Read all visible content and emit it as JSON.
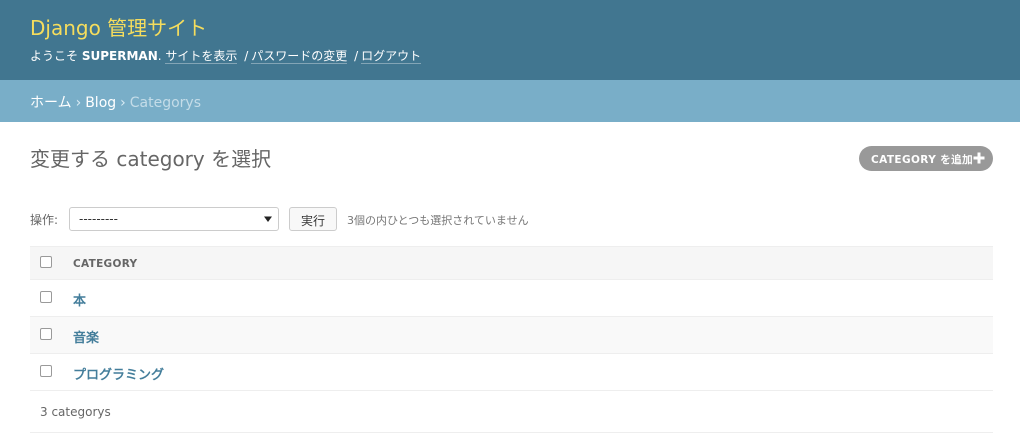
{
  "header": {
    "site_name": "Django 管理サイト",
    "welcome": "ようこそ",
    "username": "SUPERMAN",
    "username_suffix": ".",
    "links": [
      "サイトを表示",
      "パスワードの変更",
      "ログアウト"
    ],
    "separator": "/"
  },
  "breadcrumbs": {
    "home": "ホーム",
    "app": "Blog",
    "current": "Categorys",
    "separator": "›"
  },
  "page": {
    "title": "変更する category を選択",
    "add_button": "CATEGORY を追加"
  },
  "actions": {
    "label": "操作:",
    "selected_option": "---------",
    "go_label": "実行",
    "counter": "3個の内ひとつも選択されていません"
  },
  "table": {
    "column_header": "CATEGORY",
    "rows": [
      "本",
      "音楽",
      "プログラミング"
    ]
  },
  "paginator": {
    "text": "3 categorys"
  },
  "colors": {
    "header_bg": "#417690",
    "site_name": "#f5dd5d",
    "breadcrumbs_bg": "#79aec8",
    "link": "#447e9b",
    "add_button_bg": "#999999"
  },
  "icons": {
    "add": "plus-icon",
    "select": "chevron-down-icon"
  }
}
